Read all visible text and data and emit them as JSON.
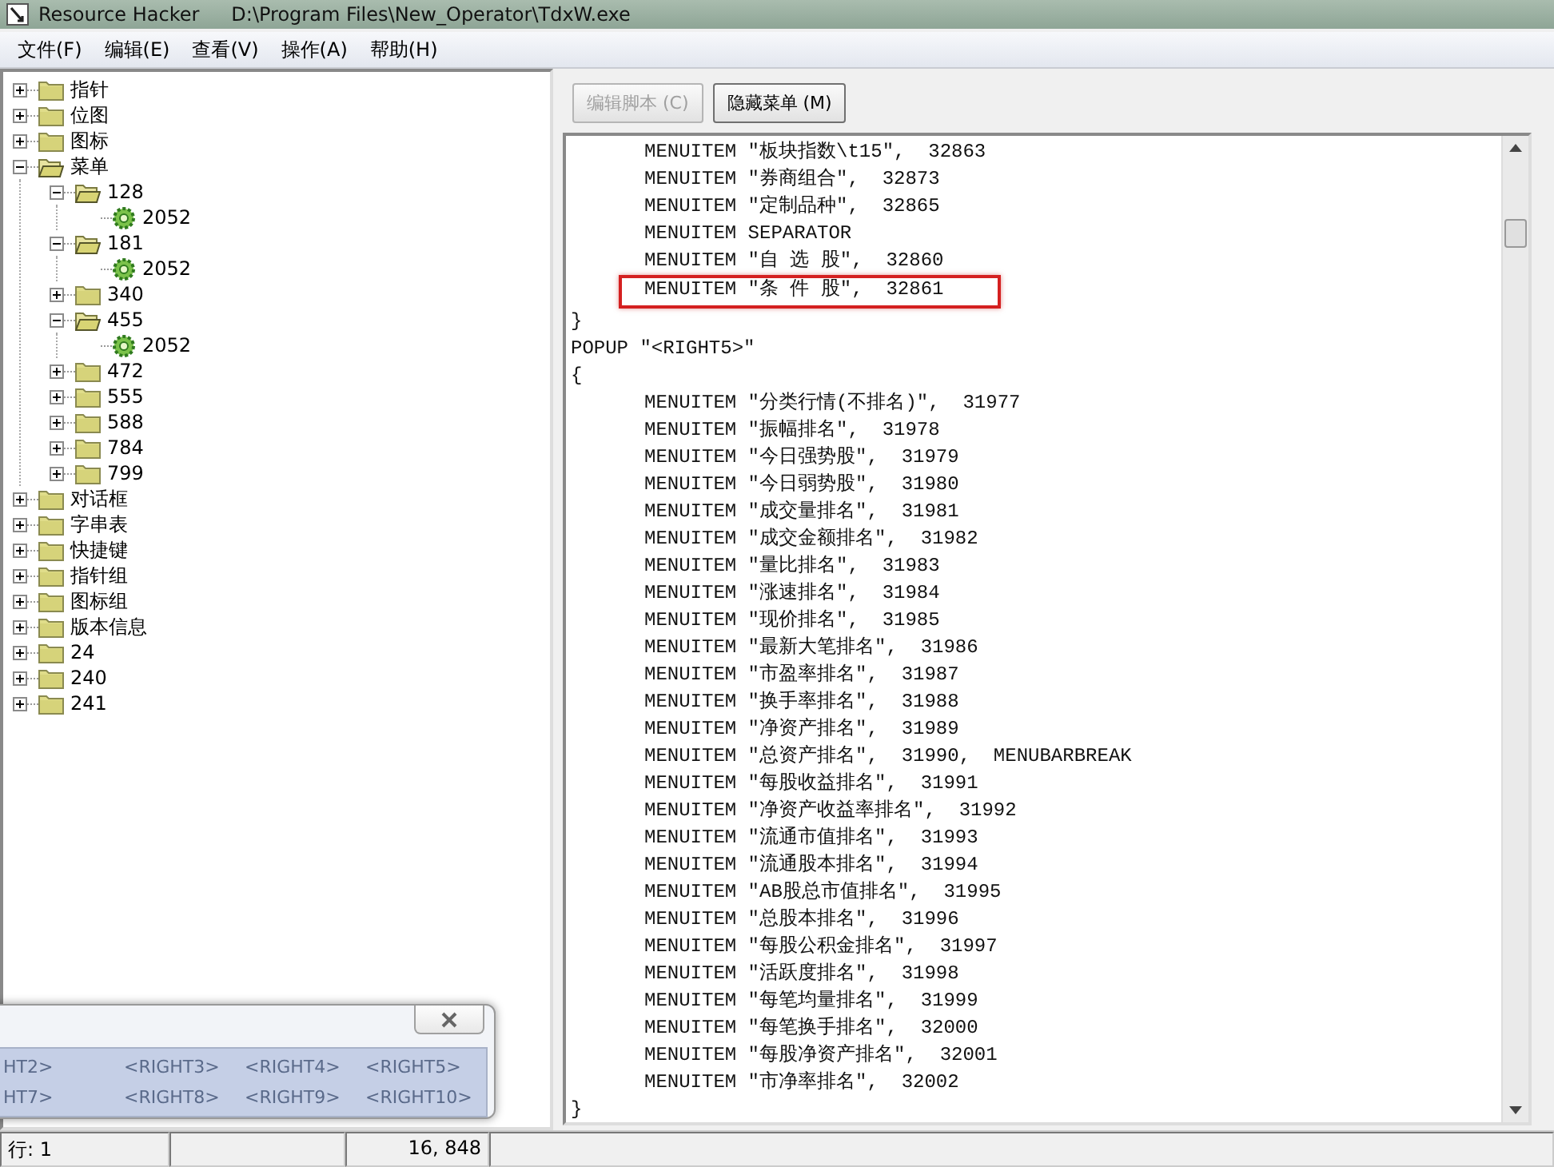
{
  "window": {
    "title": "Resource Hacker",
    "path": "D:\\Program Files\\New_Operator\\TdxW.exe"
  },
  "menu": [
    "文件(F)",
    "编辑(E)",
    "查看(V)",
    "操作(A)",
    "帮助(H)"
  ],
  "tree": [
    {
      "label": "指针",
      "kind": "folder",
      "expanded": false
    },
    {
      "label": "位图",
      "kind": "folder",
      "expanded": false
    },
    {
      "label": "图标",
      "kind": "folder",
      "expanded": false
    },
    {
      "label": "菜单",
      "kind": "folder",
      "expanded": true,
      "children": [
        {
          "label": "128",
          "kind": "folder",
          "expanded": true,
          "children": [
            {
              "label": "2052",
              "kind": "resource"
            }
          ]
        },
        {
          "label": "181",
          "kind": "folder",
          "expanded": true,
          "children": [
            {
              "label": "2052",
              "kind": "resource"
            }
          ]
        },
        {
          "label": "340",
          "kind": "folder",
          "expanded": false
        },
        {
          "label": "455",
          "kind": "folder",
          "expanded": true,
          "children": [
            {
              "label": "2052",
              "kind": "resource"
            }
          ]
        },
        {
          "label": "472",
          "kind": "folder",
          "expanded": false
        },
        {
          "label": "555",
          "kind": "folder",
          "expanded": false
        },
        {
          "label": "588",
          "kind": "folder",
          "expanded": false
        },
        {
          "label": "784",
          "kind": "folder",
          "expanded": false
        },
        {
          "label": "799",
          "kind": "folder",
          "expanded": false
        }
      ]
    },
    {
      "label": "对话框",
      "kind": "folder",
      "expanded": false
    },
    {
      "label": "字串表",
      "kind": "folder",
      "expanded": false
    },
    {
      "label": "快捷键",
      "kind": "folder",
      "expanded": false
    },
    {
      "label": "指针组",
      "kind": "folder",
      "expanded": false
    },
    {
      "label": "图标组",
      "kind": "folder",
      "expanded": false
    },
    {
      "label": "版本信息",
      "kind": "folder",
      "expanded": false
    },
    {
      "label": "24",
      "kind": "folder",
      "expanded": false
    },
    {
      "label": "240",
      "kind": "folder",
      "expanded": false
    },
    {
      "label": "241",
      "kind": "folder",
      "expanded": false
    }
  ],
  "buttons": [
    {
      "label": "编辑脚本 (C)",
      "disabled": true
    },
    {
      "label": "隐藏菜单 (M)",
      "disabled": false
    }
  ],
  "code_lines": [
    {
      "text": "MENUITEM \"板块指数\\t15\",  32863",
      "kind": "item",
      "highlighted": false
    },
    {
      "text": "MENUITEM \"券商组合\",  32873",
      "kind": "item",
      "highlighted": false
    },
    {
      "text": "MENUITEM \"定制品种\",  32865",
      "kind": "item",
      "highlighted": false
    },
    {
      "text": "MENUITEM SEPARATOR",
      "kind": "item",
      "highlighted": false
    },
    {
      "text": "MENUITEM \"自 选 股\",  32860",
      "kind": "item",
      "highlighted": false
    },
    {
      "text": "MENUITEM \"条 件 股\",  32861",
      "kind": "item",
      "highlighted": true
    },
    {
      "text": "}",
      "kind": "block",
      "highlighted": false
    },
    {
      "text": "POPUP \"<RIGHT5>\"",
      "kind": "block",
      "highlighted": false
    },
    {
      "text": "{",
      "kind": "block",
      "highlighted": false
    },
    {
      "text": "MENUITEM \"分类行情(不排名)\",  31977",
      "kind": "item",
      "highlighted": false
    },
    {
      "text": "MENUITEM \"振幅排名\",  31978",
      "kind": "item",
      "highlighted": false
    },
    {
      "text": "MENUITEM \"今日强势股\",  31979",
      "kind": "item",
      "highlighted": false
    },
    {
      "text": "MENUITEM \"今日弱势股\",  31980",
      "kind": "item",
      "highlighted": false
    },
    {
      "text": "MENUITEM \"成交量排名\",  31981",
      "kind": "item",
      "highlighted": false
    },
    {
      "text": "MENUITEM \"成交金额排名\",  31982",
      "kind": "item",
      "highlighted": false
    },
    {
      "text": "MENUITEM \"量比排名\",  31983",
      "kind": "item",
      "highlighted": false
    },
    {
      "text": "MENUITEM \"涨速排名\",  31984",
      "kind": "item",
      "highlighted": false
    },
    {
      "text": "MENUITEM \"现价排名\",  31985",
      "kind": "item",
      "highlighted": false
    },
    {
      "text": "MENUITEM \"最新大笔排名\",  31986",
      "kind": "item",
      "highlighted": false
    },
    {
      "text": "MENUITEM \"市盈率排名\",  31987",
      "kind": "item",
      "highlighted": false
    },
    {
      "text": "MENUITEM \"换手率排名\",  31988",
      "kind": "item",
      "highlighted": false
    },
    {
      "text": "MENUITEM \"净资产排名\",  31989",
      "kind": "item",
      "highlighted": false
    },
    {
      "text": "MENUITEM \"总资产排名\",  31990,  MENUBARBREAK",
      "kind": "item",
      "highlighted": false
    },
    {
      "text": "MENUITEM \"每股收益排名\",  31991",
      "kind": "item",
      "highlighted": false
    },
    {
      "text": "MENUITEM \"净资产收益率排名\",  31992",
      "kind": "item",
      "highlighted": false
    },
    {
      "text": "MENUITEM \"流通市值排名\",  31993",
      "kind": "item",
      "highlighted": false
    },
    {
      "text": "MENUITEM \"流通股本排名\",  31994",
      "kind": "item",
      "highlighted": false
    },
    {
      "text": "MENUITEM \"AB股总市值排名\",  31995",
      "kind": "item",
      "highlighted": false
    },
    {
      "text": "MENUITEM \"总股本排名\",  31996",
      "kind": "item",
      "highlighted": false
    },
    {
      "text": "MENUITEM \"每股公积金排名\",  31997",
      "kind": "item",
      "highlighted": false
    },
    {
      "text": "MENUITEM \"活跃度排名\",  31998",
      "kind": "item",
      "highlighted": false
    },
    {
      "text": "MENUITEM \"每笔均量排名\",  31999",
      "kind": "item",
      "highlighted": false
    },
    {
      "text": "MENUITEM \"每笔换手排名\",  32000",
      "kind": "item",
      "highlighted": false
    },
    {
      "text": "MENUITEM \"每股净资产排名\",  32001",
      "kind": "item",
      "highlighted": false
    },
    {
      "text": "MENUITEM \"市净率排名\",  32002",
      "kind": "item",
      "highlighted": false
    },
    {
      "text": "}",
      "kind": "block",
      "highlighted": false
    }
  ],
  "popup_window": {
    "rows": [
      [
        "HT2>",
        "<RIGHT3>",
        "<RIGHT4>",
        "<RIGHT5>"
      ],
      [
        "HT7>",
        "<RIGHT8>",
        "<RIGHT9>",
        "<RIGHT10>"
      ]
    ]
  },
  "status_bar": [
    "行: 1",
    "16, 848"
  ]
}
